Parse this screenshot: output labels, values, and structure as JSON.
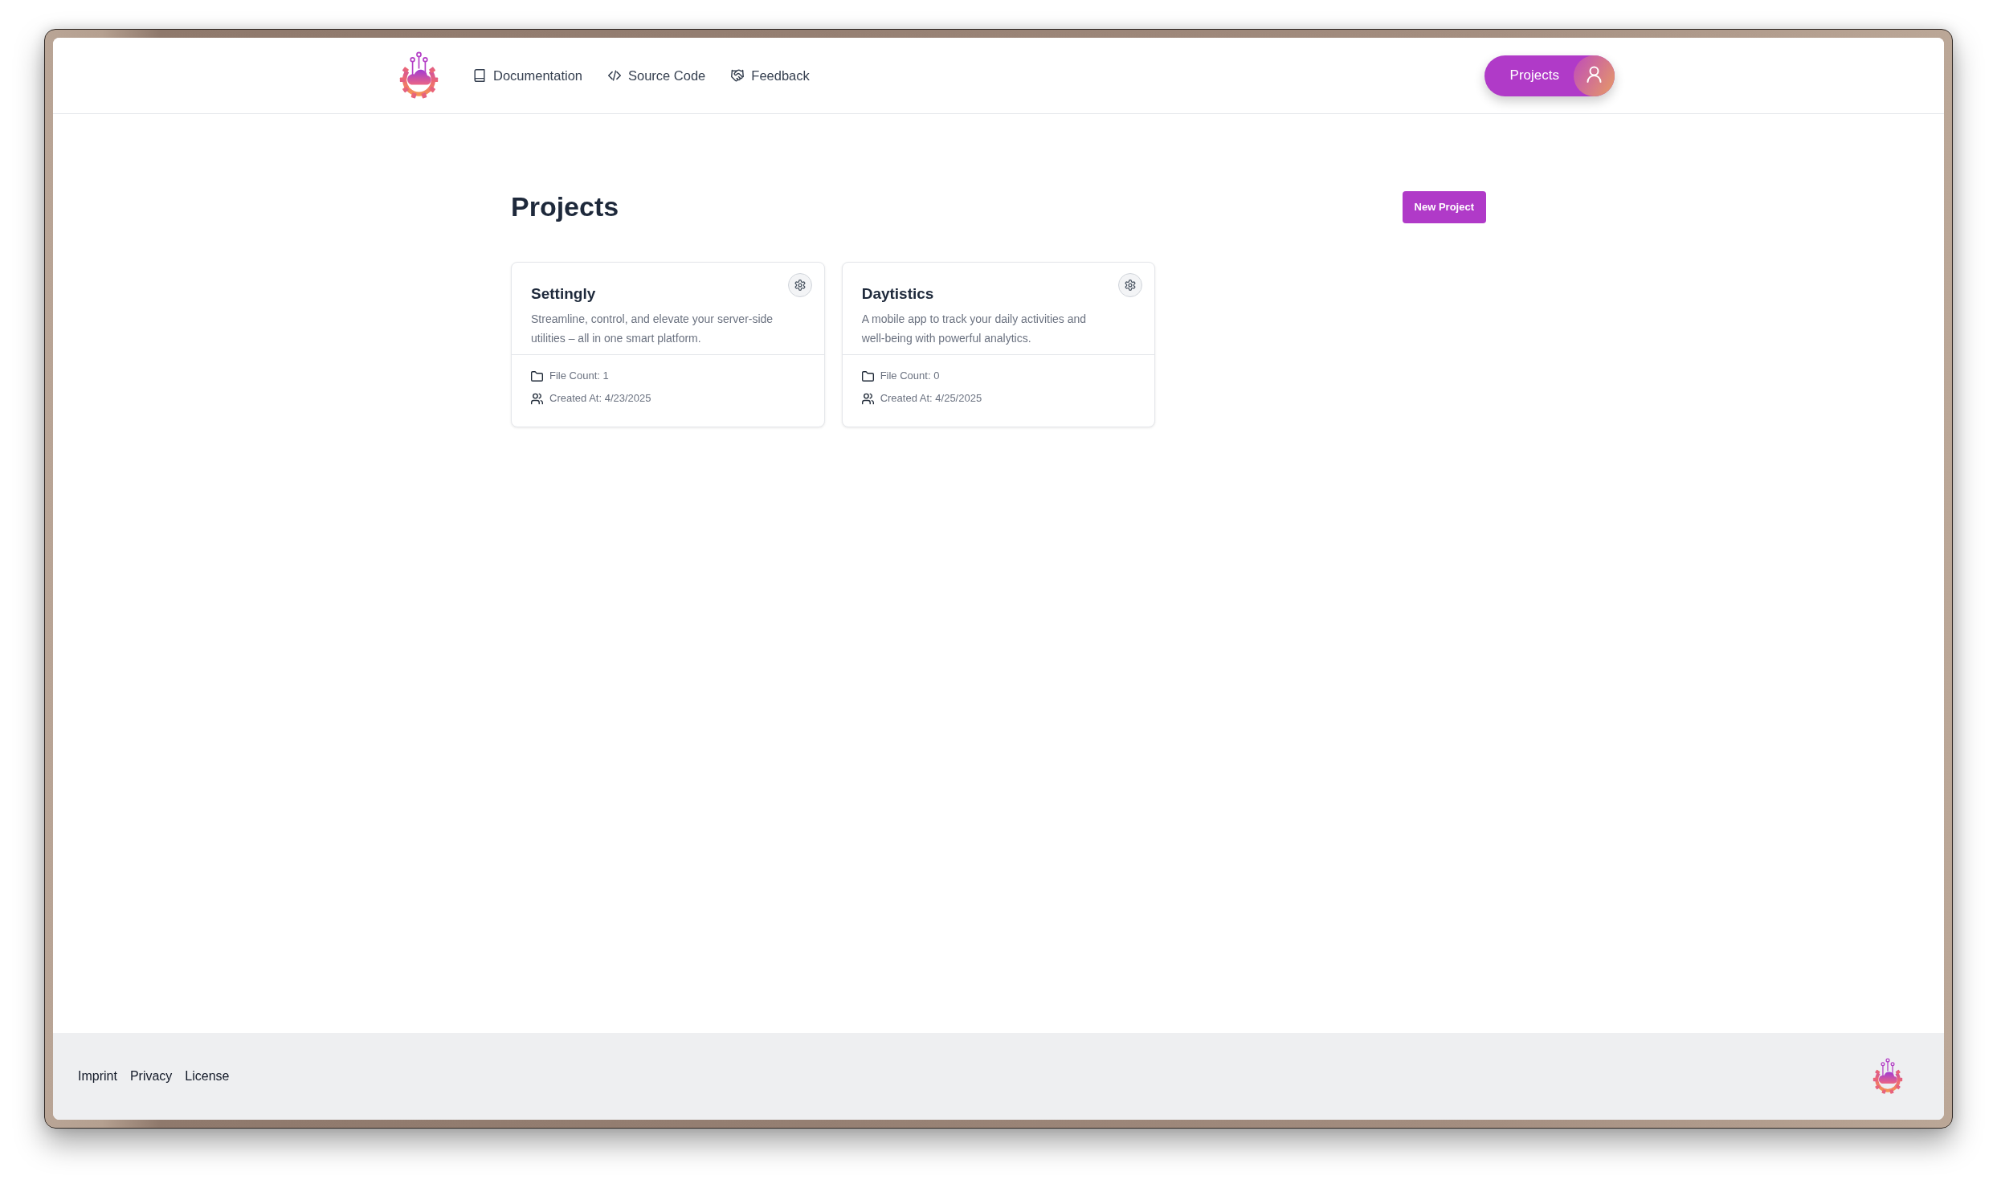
{
  "header": {
    "nav": [
      "Documentation",
      "Source Code",
      "Feedback"
    ],
    "projects_button": {
      "label": "Projects"
    }
  },
  "page": {
    "title": "Projects",
    "new_project_button": "New Project"
  },
  "projects": [
    {
      "name": "Settingly",
      "description": "Streamline, control, and elevate your server-side utilities – all in one smart platform.",
      "file_count": "File Count: 1",
      "created_at": "Created At: 4/23/2025"
    },
    {
      "name": "Daytistics",
      "description": "A mobile app to track your daily activities and well-being with powerful analytics.",
      "file_count": "File Count: 0",
      "created_at": "Created At: 4/25/2025"
    }
  ],
  "footer": {
    "links": [
      "Imprint",
      "Privacy",
      "License"
    ]
  }
}
